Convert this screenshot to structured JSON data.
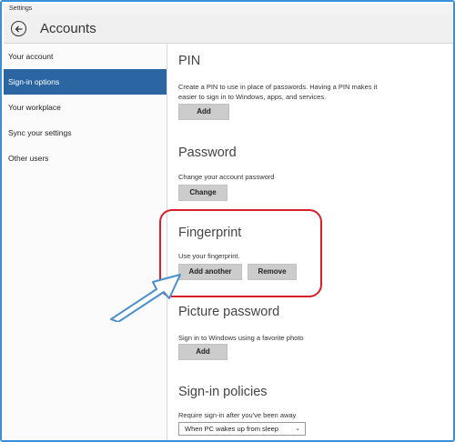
{
  "window": {
    "title": "Settings"
  },
  "header": {
    "title": "Accounts"
  },
  "sidebar": {
    "items": [
      {
        "label": "Your account"
      },
      {
        "label": "Sign-in options"
      },
      {
        "label": "Your workplace"
      },
      {
        "label": "Sync your settings"
      },
      {
        "label": "Other users"
      }
    ],
    "active_index": 1
  },
  "pin": {
    "title": "PIN",
    "description": "Create a PIN to use in place of passwords. Having a PIN makes it easier to sign in to Windows, apps, and services.",
    "add_label": "Add"
  },
  "password": {
    "title": "Password",
    "description": "Change your account password",
    "change_label": "Change"
  },
  "fingerprint": {
    "title": "Fingerprint",
    "description": "Use your fingerprint.",
    "add_another_label": "Add another",
    "remove_label": "Remove"
  },
  "picture_password": {
    "title": "Picture password",
    "description": "Sign in to Windows using a favorite photo",
    "add_label": "Add"
  },
  "signin_policies": {
    "title": "Sign-in policies",
    "description": "Require sign-in after you've been away",
    "dropdown_value": "When PC wakes up from sleep"
  },
  "colors": {
    "accent": "#2b66a3",
    "highlight": "#d81f2a",
    "frame": "#3b8fd6"
  },
  "icons": {
    "back": "back-arrow-icon",
    "dropdown": "chevron-down-icon",
    "callout": "pointer-arrow-icon"
  }
}
